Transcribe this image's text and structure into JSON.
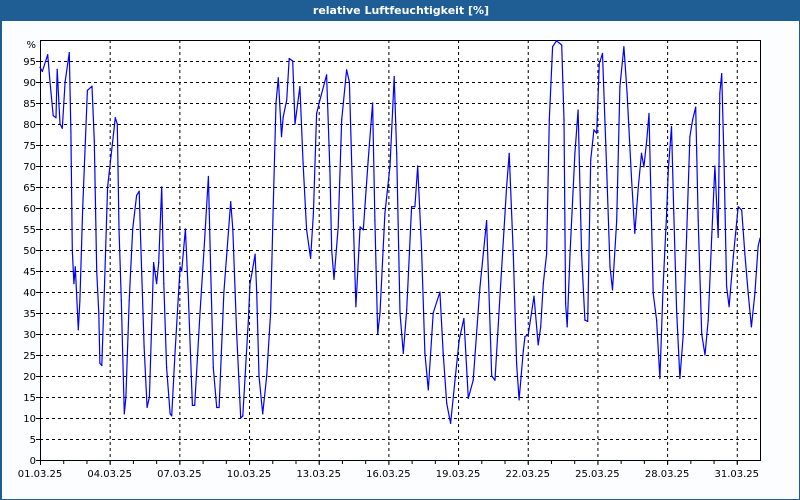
{
  "window": {
    "title": "relative Luftfeuchtigkeit [%]"
  },
  "colors": {
    "titlebar": "#1f5e94",
    "series": "#0000ff",
    "grid": "#000000"
  },
  "chart_data": {
    "type": "line",
    "title": "relative Luftfeuchtigkeit [%]",
    "xlabel": "",
    "ylabel": "%",
    "x_unit": "days since 01.03.25 00:00",
    "xlim": [
      0,
      31
    ],
    "ylim": [
      0,
      100
    ],
    "grid": true,
    "x_tick_days": [
      0,
      3,
      6,
      9,
      12,
      15,
      18,
      21,
      24,
      27,
      30
    ],
    "x_tick_labels": [
      "01.03.25",
      "04.03.25",
      "07.03.25",
      "10.03.25",
      "13.03.25",
      "16.03.25",
      "19.03.25",
      "22.03.25",
      "25.03.25",
      "28.03.25",
      "31.03.25"
    ],
    "y_ticks": [
      0,
      5,
      10,
      15,
      20,
      25,
      30,
      35,
      40,
      45,
      50,
      55,
      60,
      65,
      70,
      75,
      80,
      85,
      90,
      95
    ],
    "y_tick_labels": [
      "0",
      "5",
      "10",
      "15",
      "20",
      "25",
      "30",
      "35",
      "40",
      "45",
      "50",
      "55",
      "60",
      "65",
      "70",
      "75",
      "80",
      "85",
      "90",
      "95"
    ],
    "series": [
      {
        "name": "relative Luftfeuchtigkeit",
        "x": [
          0,
          0.1,
          0.33,
          0.43,
          0.57,
          0.69,
          0.74,
          0.86,
          0.96,
          1.08,
          1.26,
          1.33,
          1.39,
          1.46,
          1.52,
          1.65,
          1.72,
          1.84,
          2.04,
          2.24,
          2.34,
          2.44,
          2.53,
          2.58,
          2.66,
          2.77,
          2.91,
          3.03,
          3.24,
          3.33,
          3.4,
          3.5,
          3.63,
          3.7,
          3.84,
          3.99,
          4.16,
          4.27,
          4.32,
          4.48,
          4.61,
          4.71,
          4.89,
          5.02,
          5.11,
          5.24,
          5.33,
          5.45,
          5.6,
          5.67,
          5.81,
          6.03,
          6.1,
          6.26,
          6.38,
          6.56,
          6.66,
          6.89,
          7.06,
          7.25,
          7.35,
          7.46,
          7.61,
          7.71,
          7.92,
          8.21,
          8.3,
          8.47,
          8.64,
          8.73,
          8.97,
          9.04,
          9.14,
          9.26,
          9.33,
          9.43,
          9.59,
          9.76,
          9.93,
          10.04,
          10.16,
          10.26,
          10.4,
          10.47,
          10.62,
          10.73,
          10.88,
          10.98,
          11.19,
          11.33,
          11.48,
          11.65,
          11.77,
          11.91,
          12.05,
          12.34,
          12.48,
          12.56,
          12.66,
          12.84,
          12.99,
          13.2,
          13.32,
          13.49,
          13.6,
          13.78,
          13.92,
          14.13,
          14.32,
          14.42,
          14.54,
          14.64,
          14.85,
          15.07,
          15.25,
          15.36,
          15.5,
          15.64,
          15.79,
          16.0,
          16.14,
          16.26,
          16.43,
          16.57,
          16.72,
          16.93,
          17.22,
          17.36,
          17.51,
          17.68,
          17.87,
          18.05,
          18.25,
          18.44,
          18.65,
          18.94,
          19.23,
          19.45,
          19.59,
          19.8,
          20.09,
          20.2,
          20.38,
          20.52,
          20.63,
          20.81,
          20.88,
          21.02,
          21.27,
          21.45,
          21.56,
          21.67,
          21.81,
          21.93,
          22.07,
          22.24,
          22.46,
          22.56,
          22.63,
          22.7,
          22.82,
          23.03,
          23.17,
          23.32,
          23.46,
          23.58,
          23.71,
          23.85,
          23.97,
          24.08,
          24.22,
          24.4,
          24.54,
          24.65,
          24.83,
          24.97,
          25.14,
          25.28,
          25.47,
          25.61,
          25.76,
          25.9,
          26.0,
          26.12,
          26.22,
          26.33,
          26.4,
          26.55,
          26.69,
          26.83,
          26.98,
          27.05,
          27.19,
          27.29,
          27.41,
          27.55,
          27.69,
          27.84,
          27.98,
          28.1,
          28.23,
          28.34,
          28.49,
          28.63,
          28.77,
          28.92,
          29.06,
          29.2,
          29.27,
          29.35,
          29.45,
          29.56,
          29.67,
          29.85,
          30.06,
          30.21,
          30.35,
          30.49,
          30.63,
          30.78,
          30.92,
          31.0
        ],
        "y": [
          93.5,
          92.5,
          96.5,
          90,
          82,
          81.5,
          93,
          80,
          79,
          90,
          97,
          78,
          50,
          42,
          46,
          31,
          38,
          60,
          88,
          89,
          76,
          45,
          35,
          23,
          22.5,
          40,
          65,
          71,
          81.5,
          80,
          55,
          38,
          11,
          15,
          38,
          55,
          63,
          64,
          55,
          27,
          12.5,
          15,
          47,
          42,
          47,
          65,
          42,
          22,
          11,
          10.5,
          25,
          46,
          45,
          55,
          40,
          13,
          13,
          35,
          50,
          67.5,
          45,
          22,
          12.5,
          12.5,
          40,
          61.5,
          55,
          30,
          10,
          10.5,
          33,
          42,
          45,
          49,
          40,
          20,
          11,
          20,
          35,
          60,
          85,
          91,
          77,
          81.7,
          85.7,
          95.6,
          95,
          80,
          88.9,
          70.6,
          54.8,
          48,
          58.7,
          82.5,
          85.7,
          91.7,
          69,
          50,
          43,
          55.5,
          81,
          92.9,
          90,
          57,
          36.5,
          55.5,
          54.8,
          71.4,
          85,
          57,
          30,
          35,
          58.7,
          70,
          91.3,
          73,
          35,
          25.4,
          35.7,
          60.3,
          60.3,
          70,
          50,
          25.4,
          16.7,
          35,
          40,
          25.4,
          13.5,
          8.7,
          19,
          28.6,
          33.7,
          14.7,
          19,
          41,
          57,
          20,
          19,
          38.8,
          65,
          73,
          49,
          23,
          14.3,
          26,
          29.4,
          29.8,
          39,
          27.4,
          31.7,
          42,
          49,
          81,
          98.4,
          99.8,
          98.8,
          81,
          37.3,
          31.7,
          49,
          73,
          83.3,
          49,
          33.3,
          33,
          71.4,
          78.6,
          77.8,
          94.4,
          96.8,
          69,
          46,
          40.5,
          57,
          88.9,
          98.4,
          87.3,
          66.7,
          54,
          65,
          73,
          69.8,
          76,
          82.5,
          57,
          39.7,
          33.3,
          19.4,
          41.3,
          58.7,
          69,
          79.4,
          58.7,
          35.7,
          19.4,
          29.4,
          53.2,
          77,
          81,
          84,
          57,
          30,
          25,
          33.3,
          53,
          70,
          53,
          87.3,
          92,
          71.4,
          41.3,
          36.5,
          48.4,
          60.3,
          59.5,
          49,
          39.7,
          31.7,
          39.7,
          50.8,
          52.8
        ]
      }
    ]
  }
}
